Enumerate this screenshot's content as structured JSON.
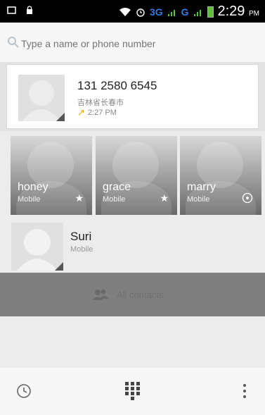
{
  "status_bar": {
    "network_3g": "3G",
    "network_g": "G",
    "time": "2:29",
    "ampm": "PM"
  },
  "search": {
    "placeholder": "Type a name or phone number"
  },
  "recent_call": {
    "number": "131 2580 6545",
    "location": "吉林省长春市",
    "time": "2:27 PM"
  },
  "favorites": [
    {
      "name": "honey",
      "type": "Mobile",
      "action_icon": "star-icon"
    },
    {
      "name": "grace",
      "type": "Mobile",
      "action_icon": "star-icon"
    },
    {
      "name": "marry",
      "type": "Mobile",
      "action_icon": "visibility-icon"
    }
  ],
  "contact": {
    "name": "Suri",
    "type": "Mobile"
  },
  "all_contacts": {
    "label": "All contacts",
    "icon": "people-icon"
  },
  "bottom_bar": {
    "icons": [
      "clock-icon",
      "dialpad-icon",
      "more-vert-icon"
    ]
  },
  "colors": {
    "status_bar": "#000000",
    "accent_green": "#59c93a",
    "accent_blue": "#2f7de0",
    "missed_arrow": "#f0a400"
  }
}
